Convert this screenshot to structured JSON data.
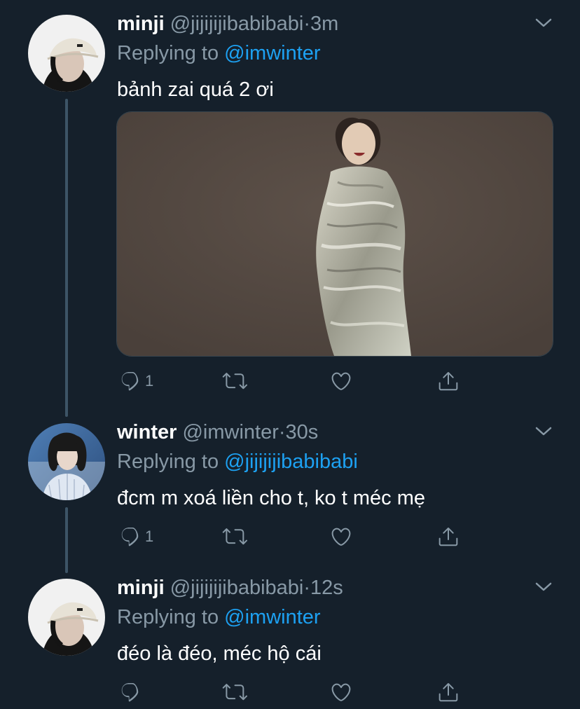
{
  "tweets": [
    {
      "name": "minji",
      "handle": "@jijijijibabibabi",
      "separator": "·",
      "time": "3m",
      "replying_prefix": "Replying to",
      "replying_to": "@imwinter",
      "text": "bảnh zai quá 2 ơi",
      "reply_count": "1",
      "has_media": true
    },
    {
      "name": "winter",
      "handle": "@imwinter",
      "separator": "·",
      "time": "30s",
      "replying_prefix": "Replying to",
      "replying_to": "@jijijijibabibabi",
      "text": "đcm m xoá liền cho t, ko t méc mẹ",
      "reply_count": "1",
      "has_media": false
    },
    {
      "name": "minji",
      "handle": "@jijijijibabibabi",
      "separator": "·",
      "time": "12s",
      "replying_prefix": "Replying to",
      "replying_to": "@imwinter",
      "text": "đéo là đéo, méc hộ cái",
      "reply_count": "",
      "has_media": false
    }
  ],
  "icons": {
    "reply": "reply-icon",
    "retweet": "retweet-icon",
    "like": "like-icon",
    "share": "share-icon",
    "more": "chevron-down-icon"
  },
  "colors": {
    "background": "#15202b",
    "text": "#ffffff",
    "secondary": "#8899a6",
    "link": "#1da1f2",
    "thread_line": "#3d5466"
  }
}
